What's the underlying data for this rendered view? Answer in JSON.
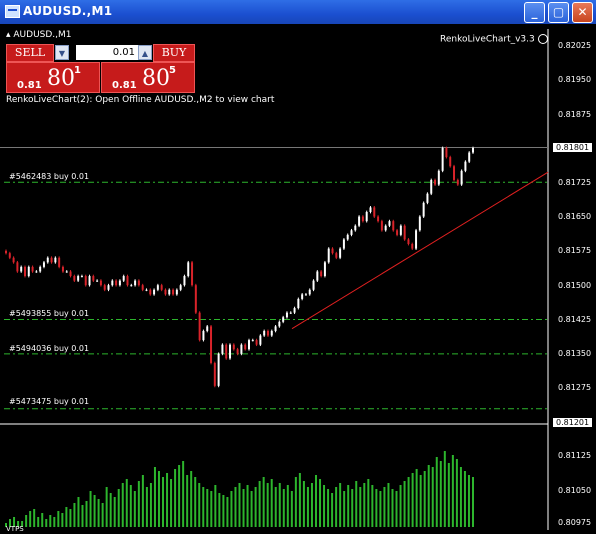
{
  "window": {
    "title": "AUDUSD.,M1",
    "buttons": [
      "minimize",
      "maximize",
      "close"
    ]
  },
  "chart": {
    "symbol": "AUDUSD.,M1",
    "indicator_name": "RenkoLiveChart_v3.3",
    "info": "RenkoLiveChart(2): Open Offline AUDUSD.,M2 to view chart",
    "trade_panel": {
      "sell_label": "SELL",
      "buy_label": "BUY",
      "lot": "0.01",
      "sell_small": "0.81",
      "sell_big": "80",
      "sell_sup": "1",
      "buy_small": "0.81",
      "buy_big": "80",
      "buy_sup": "5"
    },
    "orders": [
      {
        "label": "#5462483 buy 0.01",
        "price": 0.81725
      },
      {
        "label": "#5493855 buy 0.01",
        "price": 0.81425
      },
      {
        "label": "#5494036 buy 0.01",
        "price": 0.8135
      },
      {
        "label": "#5473475 buy 0.01",
        "price": 0.8123
      }
    ],
    "price_axis": [
      "0.82025",
      "0.81950",
      "0.81875",
      "0.81801",
      "0.81725",
      "0.81650",
      "0.81575",
      "0.81500",
      "0.81425",
      "0.81350",
      "0.81275",
      "0.81201"
    ],
    "current_price": "0.81801",
    "volume_axis": [
      "0.81125",
      "0.81050",
      "0.80975"
    ],
    "bottom_label": "VTPS",
    "colors": {
      "background": "#000000",
      "bull": "#ffffff",
      "bear": "#d9232a",
      "order_line": "#2db52d",
      "volume": "#2db52d",
      "trendline": "#e02020"
    }
  },
  "chart_data": {
    "type": "candlestick",
    "ylim": [
      0.81201,
      0.82025
    ],
    "closes": [
      0.8157,
      0.8156,
      0.8155,
      0.8153,
      0.8154,
      0.8152,
      0.8154,
      0.8153,
      0.8153,
      0.8154,
      0.8155,
      0.8156,
      0.8155,
      0.8156,
      0.8154,
      0.8153,
      0.8153,
      0.8152,
      0.8151,
      0.8152,
      0.8152,
      0.815,
      0.8152,
      0.8151,
      0.8151,
      0.815,
      0.8149,
      0.815,
      0.8151,
      0.815,
      0.8151,
      0.8152,
      0.815,
      0.815,
      0.8151,
      0.815,
      0.8149,
      0.8149,
      0.8148,
      0.8149,
      0.815,
      0.8149,
      0.8148,
      0.8149,
      0.8148,
      0.8149,
      0.815,
      0.8152,
      0.8155,
      0.815,
      0.8144,
      0.8138,
      0.814,
      0.8141,
      0.8133,
      0.8128,
      0.8135,
      0.8137,
      0.8134,
      0.8137,
      0.8136,
      0.8135,
      0.8137,
      0.8136,
      0.8138,
      0.8138,
      0.8137,
      0.8139,
      0.814,
      0.8139,
      0.814,
      0.8141,
      0.8142,
      0.8143,
      0.8144,
      0.8144,
      0.8145,
      0.8147,
      0.8148,
      0.8148,
      0.8149,
      0.8151,
      0.8153,
      0.8152,
      0.8155,
      0.8158,
      0.8157,
      0.8156,
      0.8158,
      0.816,
      0.8161,
      0.8162,
      0.8163,
      0.8165,
      0.8164,
      0.8166,
      0.8167,
      0.8165,
      0.8164,
      0.8162,
      0.8163,
      0.8164,
      0.8162,
      0.8161,
      0.8163,
      0.816,
      0.8159,
      0.8158,
      0.8162,
      0.8165,
      0.8168,
      0.817,
      0.8173,
      0.8172,
      0.8175,
      0.818,
      0.8178,
      0.8176,
      0.8173,
      0.8172,
      0.8175,
      0.8177,
      0.8179,
      0.818
    ],
    "volume": [
      2,
      4,
      5,
      3,
      3,
      6,
      8,
      9,
      5,
      7,
      4,
      6,
      5,
      8,
      7,
      10,
      9,
      12,
      15,
      11,
      13,
      18,
      16,
      14,
      12,
      20,
      17,
      15,
      19,
      22,
      24,
      21,
      18,
      23,
      26,
      20,
      22,
      30,
      28,
      25,
      27,
      24,
      29,
      31,
      33,
      26,
      28,
      25,
      22,
      20,
      19,
      18,
      21,
      17,
      16,
      15,
      18,
      20,
      22,
      19,
      21,
      18,
      20,
      23,
      25,
      22,
      24,
      20,
      22,
      19,
      21,
      18,
      25,
      27,
      23,
      20,
      22,
      26,
      24,
      21,
      19,
      17,
      20,
      22,
      18,
      21,
      19,
      23,
      20,
      22,
      24,
      21,
      19,
      18,
      20,
      22,
      19,
      18,
      21,
      23,
      25,
      27,
      29,
      26,
      28,
      31,
      30,
      35,
      33,
      38,
      32,
      36,
      34,
      30,
      28,
      26,
      25
    ]
  }
}
